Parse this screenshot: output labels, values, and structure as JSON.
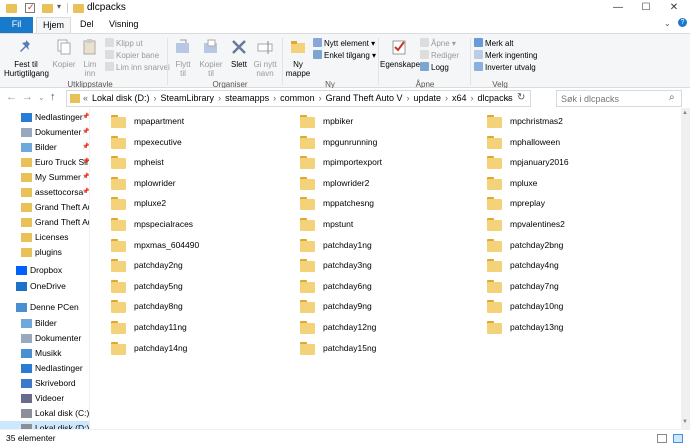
{
  "window": {
    "title": "dlcpacks",
    "controls": [
      "—",
      "☐",
      "✕"
    ]
  },
  "tabs": [
    {
      "label": "Fil"
    },
    {
      "label": "Hjem"
    },
    {
      "label": "Del"
    },
    {
      "label": "Visning"
    }
  ],
  "ribbon": {
    "groups": [
      "Utklippstavle",
      "Organiser",
      "Ny",
      "Åpne",
      "Velg"
    ],
    "pin": "Fest til\nHurtigtilgang",
    "copy": "Kopier",
    "paste": "Lim\ninn",
    "cut": "Klipp ut",
    "copy_path": "Kopier bane",
    "paste_shortcut": "Lim inn snarvei",
    "move_to": "Flytt\ntil",
    "copy_to": "Kopier\ntil",
    "delete": "Slett",
    "rename": "Gi nytt\nnavn",
    "new_folder": "Ny\nmappe",
    "new_item": "Nytt element",
    "easy_access": "Enkel tilgang",
    "properties": "Egenskaper",
    "open": "Åpne",
    "edit": "Rediger",
    "history": "Logg",
    "select_all": "Merk alt",
    "select_none": "Merk ingenting",
    "invert": "Inverter utvalg"
  },
  "address": {
    "crumbs": [
      "Lokal disk (D:)",
      "SteamLibrary",
      "steamapps",
      "common",
      "Grand Theft Auto V",
      "update",
      "x64",
      "dlcpacks"
    ],
    "search_placeholder": "Søk i dlcpacks"
  },
  "nav": [
    {
      "label": "Nedlastinger",
      "icon": "download-icon",
      "pin": true
    },
    {
      "label": "Dokumenter",
      "icon": "document-icon",
      "pin": true
    },
    {
      "label": "Bilder",
      "icon": "pictures-icon",
      "pin": true
    },
    {
      "label": "Euro Truck Sin",
      "icon": "folder-icon",
      "pin": true
    },
    {
      "label": "My Summer",
      "icon": "folder-icon",
      "pin": true
    },
    {
      "label": "assettocorsa",
      "icon": "folder-icon",
      "pin": true
    },
    {
      "label": "Grand Theft Aut",
      "icon": "folder-icon",
      "pin": false
    },
    {
      "label": "Grand Theft Aut",
      "icon": "folder-icon",
      "pin": false
    },
    {
      "label": "Licenses",
      "icon": "folder-icon",
      "pin": false
    },
    {
      "label": "plugins",
      "icon": "folder-icon",
      "pin": false
    },
    {
      "label": "Dropbox",
      "icon": "dropbox-icon",
      "pin": false
    },
    {
      "label": "OneDrive",
      "icon": "onedrive-icon",
      "pin": false
    },
    {
      "label": "Denne PCen",
      "icon": "computer-icon",
      "pin": false
    },
    {
      "label": "Bilder",
      "icon": "pictures-icon",
      "pin": false
    },
    {
      "label": "Dokumenter",
      "icon": "document-icon",
      "pin": false
    },
    {
      "label": "Musikk",
      "icon": "music-icon",
      "pin": false
    },
    {
      "label": "Nedlastinger",
      "icon": "download-icon",
      "pin": false
    },
    {
      "label": "Skrivebord",
      "icon": "desktop-icon",
      "pin": false
    },
    {
      "label": "Videoer",
      "icon": "video-icon",
      "pin": false
    },
    {
      "label": "Lokal disk (C:)",
      "icon": "drive-icon",
      "pin": false
    },
    {
      "label": "Lokal disk (D:)",
      "icon": "drive-icon",
      "pin": false
    }
  ],
  "files": [
    [
      "mpapartment",
      "mpbiker",
      "mpchristmas2"
    ],
    [
      "mpexecutive",
      "mpgunrunning",
      "mphalloween"
    ],
    [
      "mpheist",
      "mpimportexport",
      "mpjanuary2016"
    ],
    [
      "mplowrider",
      "mplowrider2",
      "mpluxe"
    ],
    [
      "mpluxe2",
      "mppatchesng",
      "mpreplay"
    ],
    [
      "mpspecialraces",
      "mpstunt",
      "mpvalentines2"
    ],
    [
      "mpxmas_604490",
      "patchday1ng",
      "patchday2bng"
    ],
    [
      "patchday2ng",
      "patchday3ng",
      "patchday4ng"
    ],
    [
      "patchday5ng",
      "patchday6ng",
      "patchday7ng"
    ],
    [
      "patchday8ng",
      "patchday9ng",
      "patchday10ng"
    ],
    [
      "patchday11ng",
      "patchday12ng",
      "patchday13ng"
    ],
    [
      "patchday14ng",
      "patchday15ng",
      ""
    ]
  ],
  "status": {
    "count": "35 elementer"
  },
  "colors": {
    "accent": "#1979ca",
    "folder": "#f3d27a",
    "selection": "#cce8ff"
  }
}
